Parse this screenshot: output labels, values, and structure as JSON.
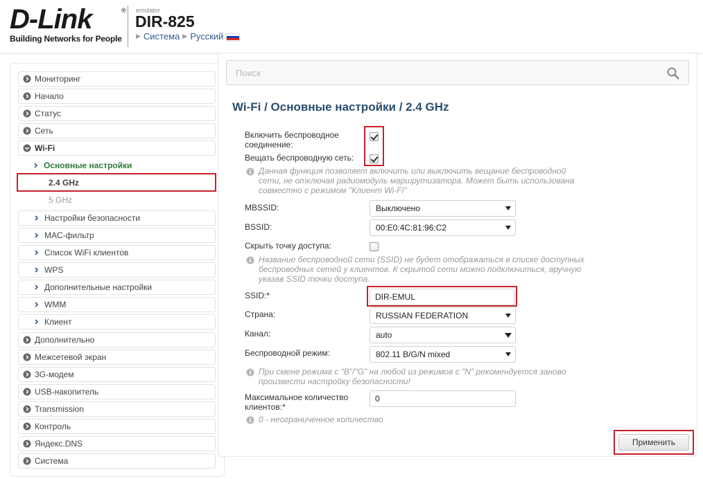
{
  "header": {
    "logo_text": "D-Link",
    "logo_reg": "®",
    "logo_tagline": "Building Networks for People",
    "emulator_label": "emulator",
    "model": "DIR-825",
    "system_link": "Система",
    "language_link": "Русский",
    "flag_colors": [
      "#ffffff",
      "#1c3fae",
      "#d52b1e"
    ]
  },
  "sidebar": {
    "items": [
      {
        "label": "Мониторинг",
        "icon": "chevron-right-circle-icon"
      },
      {
        "label": "Начало",
        "icon": "chevron-right-circle-icon"
      },
      {
        "label": "Статус",
        "icon": "chevron-right-circle-icon"
      },
      {
        "label": "Сеть",
        "icon": "chevron-right-circle-icon"
      },
      {
        "label": "Wi-Fi",
        "icon": "chevron-down-circle-icon"
      },
      {
        "label": "Основные настройки",
        "icon": "chevron-right-icon"
      },
      {
        "label": "2.4 GHz"
      },
      {
        "label": "5 GHz"
      },
      {
        "label": "Настройки безопасности",
        "icon": "chevron-right-icon"
      },
      {
        "label": "MAC-фильтр",
        "icon": "chevron-right-icon"
      },
      {
        "label": "Список WiFi клиентов",
        "icon": "chevron-right-icon"
      },
      {
        "label": "WPS",
        "icon": "chevron-right-icon"
      },
      {
        "label": "Дополнительные настройки",
        "icon": "chevron-right-icon"
      },
      {
        "label": "WMM",
        "icon": "chevron-right-icon"
      },
      {
        "label": "Клиент",
        "icon": "chevron-right-icon"
      },
      {
        "label": "Дополнительно",
        "icon": "chevron-right-circle-icon"
      },
      {
        "label": "Межсетевой экран",
        "icon": "chevron-right-circle-icon"
      },
      {
        "label": "3G-модем",
        "icon": "chevron-right-circle-icon"
      },
      {
        "label": "USB-накопитель",
        "icon": "chevron-right-circle-icon"
      },
      {
        "label": "Transmission",
        "icon": "chevron-right-circle-icon"
      },
      {
        "label": "Контроль",
        "icon": "chevron-right-circle-icon"
      },
      {
        "label": "Яндекс.DNS",
        "icon": "chevron-right-circle-icon"
      },
      {
        "label": "Система",
        "icon": "chevron-right-circle-icon"
      }
    ]
  },
  "search": {
    "placeholder": "Поиск"
  },
  "main": {
    "title": "Wi-Fi /  Основные настройки /  2.4 GHz",
    "enable_wireless_label_1": "Включить беспроводное",
    "enable_wireless_label_2": "соединение:",
    "enable_wireless_checked": true,
    "broadcast_label": "Вещать беспроводную сеть:",
    "broadcast_checked": true,
    "broadcast_hint_1": "Данная функция позволяет включить или выключить вещание беспроводной",
    "broadcast_hint_2": "сети, не отключая радиомодуль маршрутизатора. Может быть использована",
    "broadcast_hint_3": "совместно с режимом \"Клиент Wi-Fi\"",
    "mbssid_label": "MBSSID:",
    "mbssid_value": "Выключено",
    "bssid_label": "BSSID:",
    "bssid_value": "00:E0:4C:81:96:C2",
    "hide_ap_label": "Скрыть точку доступа:",
    "hide_ap_checked": false,
    "hide_hint_1": "Название беспроводной сети (SSID) не будет отображаться в списке доступных",
    "hide_hint_2": "беспроводных сетей у клиентов. К скрытой сети можно подключиться, вручную",
    "hide_hint_3": "указав SSID точки доступа.",
    "ssid_label": "SSID:*",
    "ssid_value": "DIR-EMUL",
    "country_label": "Страна:",
    "country_value": "RUSSIAN FEDERATION",
    "channel_label": "Канал:",
    "channel_value": "auto",
    "mode_label": "Беспроводной режим:",
    "mode_value": "802.11 B/G/N mixed",
    "mode_hint_1": "При смене режима с \"B\"/\"G\" на любой из режимов с \"N\" рекомендуется заново",
    "mode_hint_2": "произвести настройку безопасности!",
    "max_clients_label_1": "Максимальное количество",
    "max_clients_label_2": "клиентов:*",
    "max_clients_value": "0",
    "max_clients_hint": "0 - неограниченное количество",
    "apply_label": "Применить"
  },
  "colors": {
    "highlight": "#c8202c",
    "title": "#2a4d6e",
    "active_menu": "#2f7a3b",
    "link": "#2f5d8c"
  }
}
